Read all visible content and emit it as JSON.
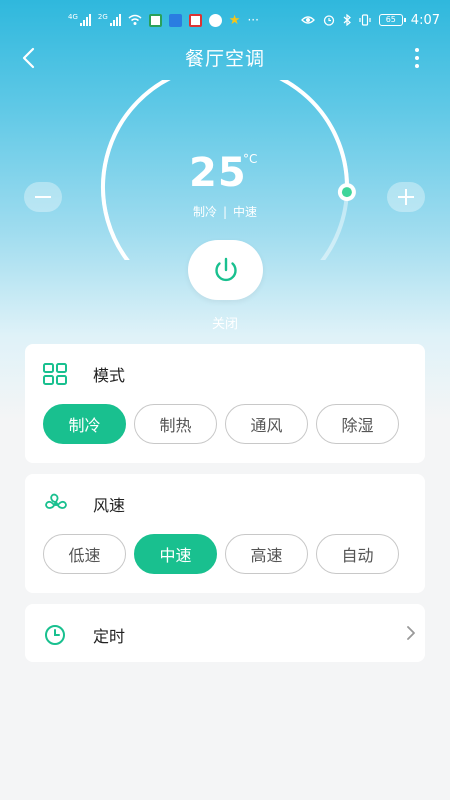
{
  "status_bar": {
    "network_1": "4G",
    "network_2": "2G",
    "battery": "65",
    "time": "4:07",
    "overflow": "···"
  },
  "header": {
    "title": "餐厅空调",
    "back_icon": "chevron-left-icon",
    "more_icon": "more-vertical-icon"
  },
  "thermostat": {
    "temperature": "25",
    "unit": "°C",
    "mode": "制冷",
    "separator": "|",
    "speed": "中速",
    "dial_level": 0.85
  },
  "power": {
    "label": "关闭",
    "icon": "power-icon"
  },
  "mode_card": {
    "title": "模式",
    "icon": "grid-icon",
    "options": [
      "制冷",
      "制热",
      "通风",
      "除湿"
    ],
    "selected": "制冷"
  },
  "speed_card": {
    "title": "风速",
    "icon": "fan-icon",
    "options": [
      "低速",
      "中速",
      "高速",
      "自动"
    ],
    "selected": "中速"
  },
  "timer_card": {
    "title": "定时",
    "icon": "clock-icon"
  },
  "colors": {
    "accent": "#19c08f",
    "sky_top": "#2fb8dd",
    "background": "#f4f5f6"
  }
}
